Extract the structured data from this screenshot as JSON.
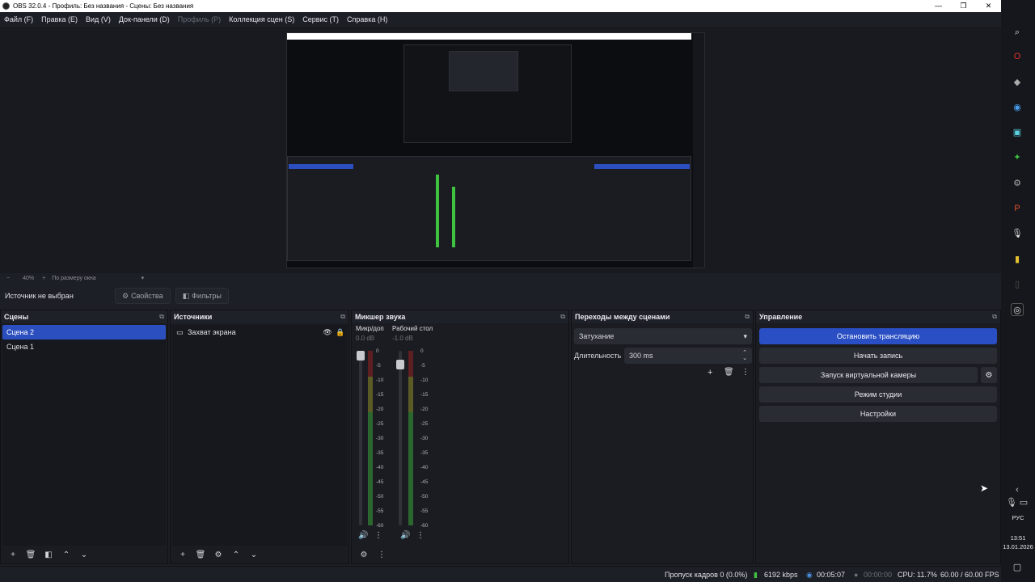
{
  "window": {
    "title": "OBS 32.0.4 - Профиль: Без названия - Сцены: Без названия",
    "minimize": "—",
    "restore": "❐",
    "close": "✕"
  },
  "menu": [
    "Файл (F)",
    "Правка (E)",
    "Вид (V)",
    "Док-панели (D)",
    "Профиль (P)",
    "Коллекция сцен (S)",
    "Сервис (T)",
    "Справка (H)"
  ],
  "zoom": {
    "minus": "−",
    "level": "40%",
    "plus": "+",
    "mode": "По размеру окна"
  },
  "source_toolbar": {
    "no_source": "Источник не выбран",
    "properties": "Свойства",
    "filters": "Фильтры"
  },
  "scenes": {
    "title": "Сцены",
    "items": [
      {
        "label": "Сцена 2",
        "selected": true
      },
      {
        "label": "Сцена 1",
        "selected": false
      }
    ]
  },
  "sources": {
    "title": "Источники",
    "items": [
      {
        "label": "Захват экрана",
        "visible": true,
        "locked": false
      }
    ]
  },
  "mixer": {
    "title": "Микшер звука",
    "channels": [
      {
        "name": "Микр/доп",
        "db": "0.0 dB",
        "fader_level": 1.0
      },
      {
        "name": "Рабочий стол",
        "db": "-1.0 dB",
        "fader_level": 0.95
      }
    ],
    "scale": [
      "0",
      "-5",
      "-10",
      "-15",
      "-20",
      "-25",
      "-30",
      "-35",
      "-40",
      "-45",
      "-50",
      "-55",
      "-60"
    ]
  },
  "transitions": {
    "title": "Переходы между сценами",
    "selected": "Затухание",
    "duration_label": "Длительность",
    "duration_value": "300 ms"
  },
  "controls": {
    "title": "Управление",
    "stop_stream": "Остановить трансляцию",
    "start_record": "Начать запись",
    "virtual_camera": "Запуск виртуальной камеры",
    "studio_mode": "Режим студии",
    "settings": "Настройки"
  },
  "status": {
    "dropped_frames": "Пропуск кадров 0 (0.0%)",
    "bitrate": "6192 kbps",
    "stream_time": "00:05:07",
    "record_time": "00:00:00",
    "cpu": "CPU: 11.7%",
    "fps": "60.00 / 60.00 FPS"
  },
  "taskbar": {
    "lang": "РУС",
    "time": "13:51",
    "date": "13.01.2026"
  },
  "colors": {
    "accent": "#2a4fc4",
    "meter_green": "#3fc23f",
    "meter_yellow": "#a8a82a",
    "meter_red": "#b02424"
  }
}
